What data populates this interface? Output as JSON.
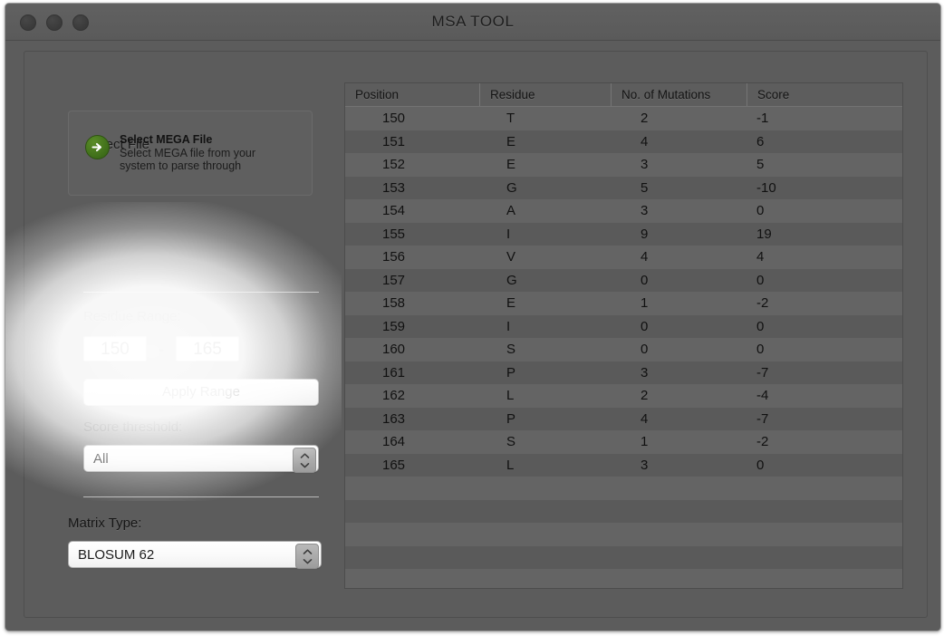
{
  "window": {
    "title": "MSA TOOL",
    "traffic_lights": [
      "close",
      "minimize",
      "zoom"
    ]
  },
  "sidebar": {
    "select_file": {
      "group_label": "Select File",
      "icon": "green-arrow-icon",
      "action_title": "Select MEGA File",
      "action_subtitle_line1": "Select MEGA file from your",
      "action_subtitle_line2": "system to parse through"
    },
    "residue_range": {
      "label": "Residue Range:",
      "start_value": "150",
      "end_value": "165",
      "separator": "-",
      "apply_button": "Apply Range"
    },
    "score_threshold": {
      "label": "Score threshold:",
      "selected": "All",
      "options": [
        "All"
      ]
    },
    "matrix_type": {
      "label": "Matrix Type:",
      "selected": "BLOSUM 62",
      "options": [
        "BLOSUM 62"
      ]
    }
  },
  "table": {
    "columns": [
      "Position",
      "Residue",
      "No. of Mutations",
      "Score"
    ],
    "rows": [
      {
        "position": "150",
        "residue": "T",
        "mutations": "2",
        "score": "-1"
      },
      {
        "position": "151",
        "residue": "E",
        "mutations": "4",
        "score": "6"
      },
      {
        "position": "152",
        "residue": "E",
        "mutations": "3",
        "score": "5"
      },
      {
        "position": "153",
        "residue": "G",
        "mutations": "5",
        "score": "-10"
      },
      {
        "position": "154",
        "residue": "A",
        "mutations": "3",
        "score": "0"
      },
      {
        "position": "155",
        "residue": "I",
        "mutations": "9",
        "score": "19"
      },
      {
        "position": "156",
        "residue": "V",
        "mutations": "4",
        "score": "4"
      },
      {
        "position": "157",
        "residue": "G",
        "mutations": "0",
        "score": "0"
      },
      {
        "position": "158",
        "residue": "E",
        "mutations": "1",
        "score": "-2"
      },
      {
        "position": "159",
        "residue": "I",
        "mutations": "0",
        "score": "0"
      },
      {
        "position": "160",
        "residue": "S",
        "mutations": "0",
        "score": "0"
      },
      {
        "position": "161",
        "residue": "P",
        "mutations": "3",
        "score": "-7"
      },
      {
        "position": "162",
        "residue": "L",
        "mutations": "2",
        "score": "-4"
      },
      {
        "position": "163",
        "residue": "P",
        "mutations": "4",
        "score": "-7"
      },
      {
        "position": "164",
        "residue": "S",
        "mutations": "1",
        "score": "-2"
      },
      {
        "position": "165",
        "residue": "L",
        "mutations": "3",
        "score": "0"
      }
    ],
    "empty_row_count": 5
  },
  "colors": {
    "window_chrome": "#5c5c5c",
    "titlebar": "#5e5e5e",
    "accent_green": "#4b7d20",
    "field_white": "#ffffff",
    "row_odd": "#646464",
    "row_even": "#5a5a5a"
  }
}
